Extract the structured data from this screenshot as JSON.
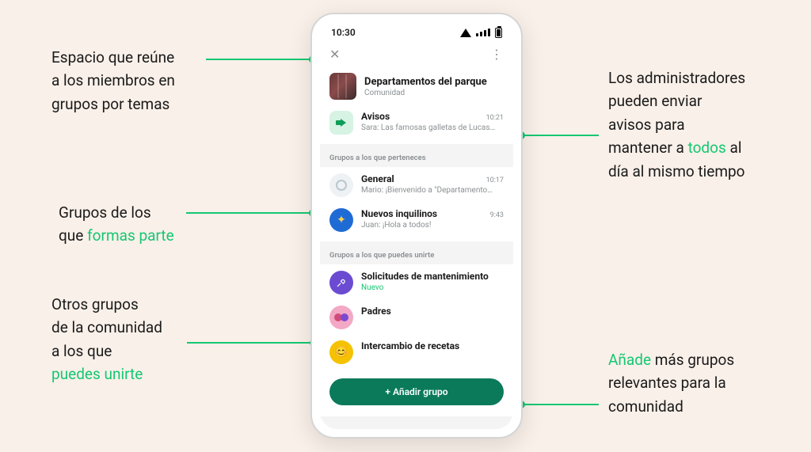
{
  "ann": {
    "top_left": {
      "l1": "Espacio que reúne",
      "l2": "a los miembros en",
      "l3": "grupos por temas"
    },
    "mid_left": {
      "l1": "Grupos de los",
      "l2a": "que ",
      "l2b": "formas parte"
    },
    "bot_left": {
      "l1": "Otros grupos",
      "l2": "de la comunidad",
      "l3": "a los que",
      "l4": "puedes unirte"
    },
    "top_right": {
      "l1": "Los administradores",
      "l2": "pueden enviar",
      "l3": "avisos para",
      "l4a": "mantener a ",
      "l4b": "todos",
      "l4c": " al",
      "l5": "día al mismo tiempo"
    },
    "bot_right": {
      "l1a": "Añade",
      "l1b": " más grupos",
      "l2": "relevantes para la",
      "l3": "comunidad"
    }
  },
  "status_time": "10:30",
  "community": {
    "name": "Departamentos del parque",
    "subtitle": "Comunidad"
  },
  "announcements": {
    "title": "Avisos",
    "time": "10:21",
    "preview": "Sara: Las famosas galletas de Lucas s…"
  },
  "section_member": "Grupos a los que perteneces",
  "groups_member": [
    {
      "title": "General",
      "time": "10:17",
      "preview": "Mario: ¡Bienvenido a \"Departamentos d…"
    },
    {
      "title": "Nuevos inquilinos",
      "time": "9:43",
      "preview": "Juan: ¡Hola a todos!"
    }
  ],
  "section_join": "Grupos a los que puedes unirte",
  "groups_join": [
    {
      "title": "Solicitudes de mantenimiento",
      "tag": "Nuevo"
    },
    {
      "title": "Padres"
    },
    {
      "title": "Intercambio de recetas"
    }
  ],
  "add_button": "+ Añadir grupo"
}
